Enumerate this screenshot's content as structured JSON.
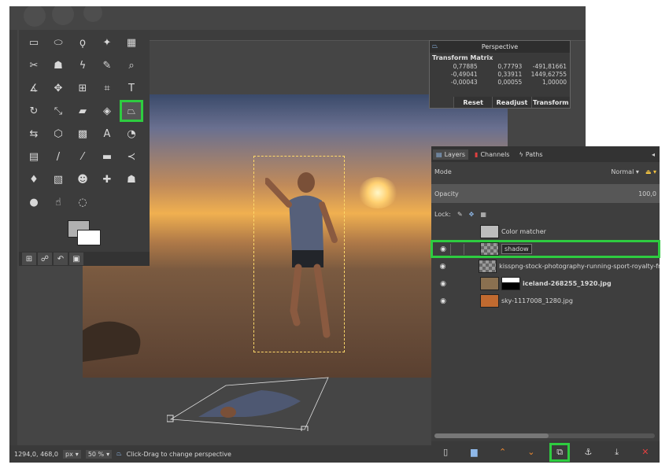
{
  "toolbox": {
    "tools": [
      {
        "icon": "rect-select-icon",
        "glyph": "▭"
      },
      {
        "icon": "ellipse-select-icon",
        "glyph": "⬭"
      },
      {
        "icon": "lasso-icon",
        "glyph": "ϙ"
      },
      {
        "icon": "magic-wand-icon",
        "glyph": "✦"
      },
      {
        "icon": "color-select-icon",
        "glyph": "▦"
      },
      {
        "icon": "scissors-icon",
        "glyph": "✂"
      },
      {
        "icon": "foreground-select-icon",
        "glyph": "☗"
      },
      {
        "icon": "paths-icon",
        "glyph": "ϟ"
      },
      {
        "icon": "color-picker-icon",
        "glyph": "✎"
      },
      {
        "icon": "zoom-icon",
        "glyph": "⌕"
      },
      {
        "icon": "measure-icon",
        "glyph": "∡"
      },
      {
        "icon": "move-icon",
        "glyph": "✥"
      },
      {
        "icon": "align-icon",
        "glyph": "⊞"
      },
      {
        "icon": "crop-icon",
        "glyph": "⌗"
      },
      {
        "icon": "text-transform-icon",
        "glyph": "T"
      },
      {
        "icon": "rotate-icon",
        "glyph": "↻"
      },
      {
        "icon": "scale-icon",
        "glyph": "⤡"
      },
      {
        "icon": "shear-icon",
        "glyph": "▰"
      },
      {
        "icon": "unified-transform-icon",
        "glyph": "◈"
      },
      {
        "icon": "perspective-icon",
        "glyph": "⏢"
      },
      {
        "icon": "flip-icon",
        "glyph": "⇆"
      },
      {
        "icon": "cage-icon",
        "glyph": "⬡"
      },
      {
        "icon": "warp-icon",
        "glyph": "▩"
      },
      {
        "icon": "text-icon",
        "glyph": "A"
      },
      {
        "icon": "bucket-fill-icon",
        "glyph": "◔"
      },
      {
        "icon": "gradient-icon",
        "glyph": "▤"
      },
      {
        "icon": "pencil-icon",
        "glyph": "/"
      },
      {
        "icon": "paintbrush-icon",
        "glyph": "⁄"
      },
      {
        "icon": "eraser-icon",
        "glyph": "▬"
      },
      {
        "icon": "airbrush-icon",
        "glyph": "≺"
      },
      {
        "icon": "ink-icon",
        "glyph": "♦"
      },
      {
        "icon": "mypaint-icon",
        "glyph": "▧"
      },
      {
        "icon": "clone-icon",
        "glyph": "☻"
      },
      {
        "icon": "heal-icon",
        "glyph": "✚"
      },
      {
        "icon": "perspective-clone-icon",
        "glyph": "☗"
      },
      {
        "icon": "blur-icon",
        "glyph": "●"
      },
      {
        "icon": "smudge-icon",
        "glyph": "☝"
      },
      {
        "icon": "dodge-burn-icon",
        "glyph": "◌"
      }
    ],
    "bottom_tabs": [
      {
        "icon": "tool-options-icon",
        "glyph": "⊞"
      },
      {
        "icon": "device-status-icon",
        "glyph": "☍"
      },
      {
        "icon": "undo-history-icon",
        "glyph": "↶"
      },
      {
        "icon": "images-icon",
        "glyph": "▣"
      }
    ]
  },
  "perspective": {
    "title": "Perspective",
    "matrix_title": "Transform Matrix",
    "matrix": [
      "0,77885",
      "0,77793",
      "-491,81661",
      "-0,49041",
      "0,33911",
      "1449,62755",
      "-0,00043",
      "0,00055",
      "1,00000"
    ],
    "buttons": {
      "reset": "Reset",
      "readjust": "Readjust",
      "transform": "Transform"
    }
  },
  "status": {
    "coords": "1294,0, 468,0",
    "unit": "px",
    "zoom": "50 %",
    "message": "Click-Drag to change perspective"
  },
  "dock": {
    "tabs": [
      "Layers",
      "Channels",
      "Paths"
    ],
    "mode_label": "Mode",
    "mode_value": "Normal",
    "opacity_label": "Opacity",
    "opacity_value": "100,0",
    "lock_label": "Lock:",
    "layers": [
      {
        "name": "Color matcher",
        "visible": false,
        "thumb": "#bdbdbd",
        "bold": false
      },
      {
        "name": "shadow",
        "visible": true,
        "thumb": "checker",
        "bold": false,
        "active": true
      },
      {
        "name": "kisspng-stock-photography-running-sport-royalty-free",
        "visible": true,
        "thumb": "checker",
        "bold": false
      },
      {
        "name": "iceland-268255_1920.jpg",
        "visible": true,
        "thumb": "#8a7050",
        "bold": true
      },
      {
        "name": "sky-1117008_1280.jpg",
        "visible": true,
        "thumb": "#c06a30",
        "bold": false
      }
    ]
  },
  "colors": {
    "highlight": "#2ecc40",
    "selection": "#ffd96a"
  }
}
